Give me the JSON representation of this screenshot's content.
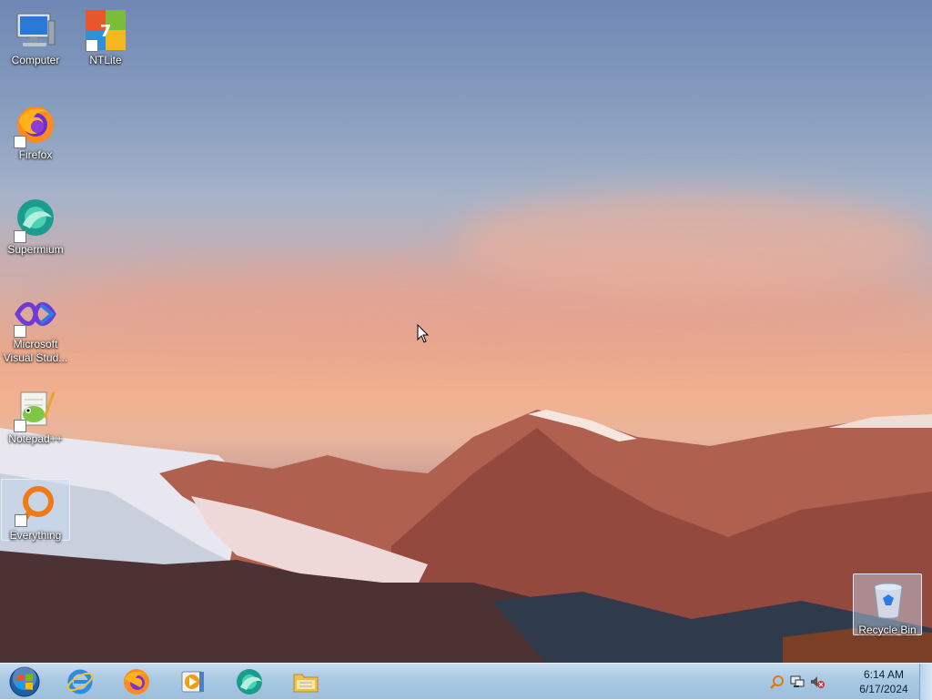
{
  "desktop": {
    "icons": [
      {
        "label": "Computer"
      },
      {
        "label": "NTLite"
      },
      {
        "label": "Firefox"
      },
      {
        "label": "Supermium"
      },
      {
        "label": "Microsoft Visual Stud..."
      },
      {
        "label": "Notepad++"
      },
      {
        "label": "Everything"
      },
      {
        "label": "Recycle Bin"
      }
    ]
  },
  "taskbar": {
    "start_icon": "windows-orb-icon",
    "pinned": [
      {
        "icon": "internet-explorer-icon"
      },
      {
        "icon": "firefox-icon"
      },
      {
        "icon": "media-player-icon"
      },
      {
        "icon": "supermium-icon"
      },
      {
        "icon": "file-explorer-icon"
      }
    ],
    "tray": {
      "icons": [
        "search-tray-icon",
        "network-icon",
        "volume-muted-icon"
      ],
      "time": "6:14 AM",
      "date": "6/17/2024"
    }
  },
  "colors": {
    "taskbar": "#a9c8e2",
    "sky_top": "#6f87b3",
    "sunset": "#f2b08f"
  }
}
